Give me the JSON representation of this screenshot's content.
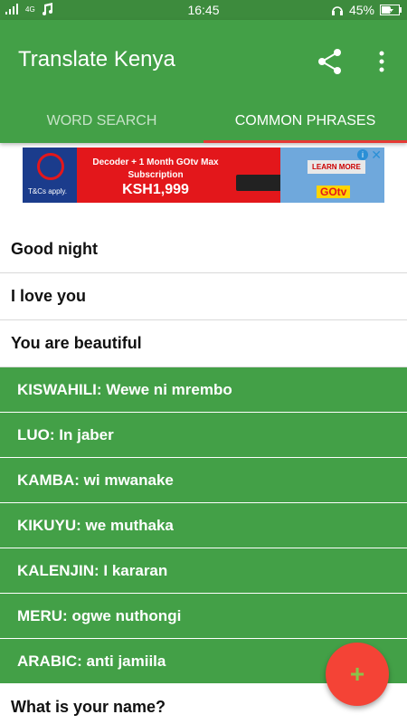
{
  "status_bar": {
    "time": "16:45",
    "battery": "45%",
    "network": "4G"
  },
  "app_bar": {
    "title": "Translate Kenya",
    "share_icon": "share-icon",
    "more_icon": "more-vert-icon",
    "color": "#43a047"
  },
  "tabs": [
    {
      "label": "WORD SEARCH"
    },
    {
      "label": "COMMON PHRASES"
    }
  ],
  "ad": {
    "line1": "Decoder + 1 Month GOtv Max",
    "line2": "Subscription",
    "price": "KSH1,999",
    "tcs": "T&Cs apply.",
    "cta": "LEARN MORE",
    "brand": "GOtv"
  },
  "phrases": [
    {
      "text": "Good night"
    },
    {
      "text": "I love you"
    },
    {
      "text": "You are beautiful"
    },
    {
      "text": "What is your name?"
    }
  ],
  "translations": [
    {
      "text": "KISWAHILI: Wewe ni mrembo"
    },
    {
      "text": "LUO: In jaber"
    },
    {
      "text": "KAMBA: wi mwanake"
    },
    {
      "text": "KIKUYU: we muthaka"
    },
    {
      "text": "KALENJIN: I kararan"
    },
    {
      "text": "MERU: ogwe nuthongi"
    },
    {
      "text": "ARABIC: anti jamiila"
    }
  ],
  "fab": {
    "icon": "plus-icon",
    "label": "+"
  }
}
